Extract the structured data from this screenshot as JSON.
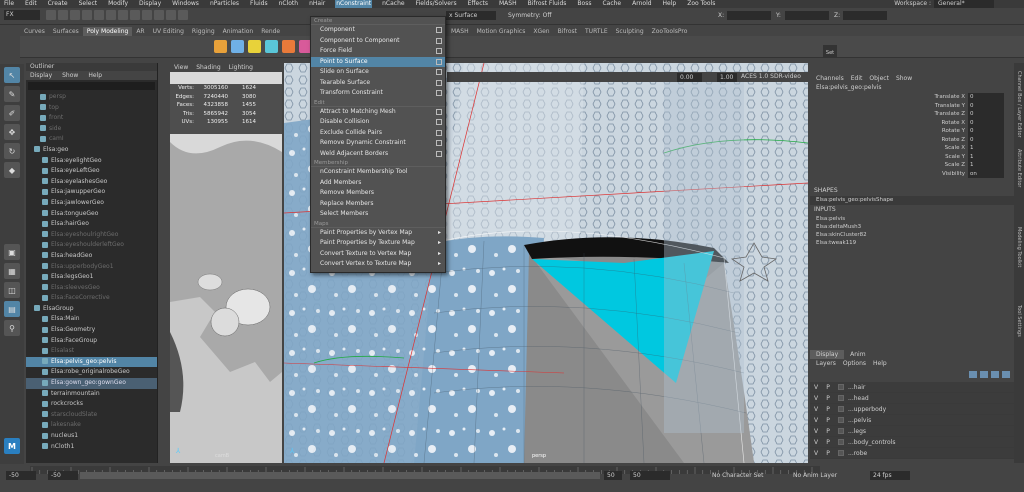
{
  "menubar": {
    "items": [
      "File",
      "Edit",
      "Create",
      "Select",
      "Modify",
      "Display",
      "Windows",
      "nParticles",
      "Fluids",
      "nCloth",
      "nHair",
      "nConstraint",
      "nCache",
      "Fields/Solvers",
      "Effects",
      "MASH",
      "Bifrost Fluids",
      "Boss",
      "Cache",
      "Arnold",
      "Help",
      "Zoo Tools"
    ],
    "active": "nConstraint",
    "workspace_label": "Workspace :",
    "workspace_value": "General*"
  },
  "statusline": {
    "mode": "FX",
    "snap_target": "x Surface",
    "symmetry": "Symmetry: Off",
    "x_label": "X:",
    "y_label": "Y:",
    "z_label": "Z:"
  },
  "shelf": {
    "tabs": [
      "Curves",
      "Surfaces",
      "Poly Modeling",
      "AR",
      "UV Editing",
      "Rigging",
      "Animation",
      "Rende"
    ],
    "active": "Poly Modeling",
    "tabs_right": [
      "MASH",
      "Motion Graphics",
      "XGen",
      "Bifrost",
      "TURTLE",
      "Sculpting",
      "ZooToolsPro"
    ],
    "set_label": "Set",
    "icon_colors": [
      "#e8a13a",
      "#6fb0e6",
      "#e8d23a",
      "#5ac6d8",
      "#e87a3a",
      "#d85a9a",
      "#7ad85a",
      "#e8a13a",
      "#6fb0e6",
      "#b07ae6",
      "#e8d23a",
      "#5ac6d8"
    ]
  },
  "outliner": {
    "title": "Outliner",
    "menu": [
      "Display",
      "Show",
      "Help"
    ],
    "items": [
      {
        "label": "persp",
        "style": "dim"
      },
      {
        "label": "top",
        "style": "dim"
      },
      {
        "label": "front",
        "style": "dim"
      },
      {
        "label": "side",
        "style": "dim"
      },
      {
        "label": "camI",
        "style": "dim"
      },
      {
        "label": "Elsa:geo",
        "style": "normal"
      },
      {
        "label": "Elsa:eyelightGeo",
        "style": "normal"
      },
      {
        "label": "Elsa:eyeLeftGeo",
        "style": "normal"
      },
      {
        "label": "Elsa:eyelashesGeo",
        "style": "normal"
      },
      {
        "label": "Elsa:jawupperGeo",
        "style": "normal"
      },
      {
        "label": "Elsa:jawlowerGeo",
        "style": "normal"
      },
      {
        "label": "Elsa:tongueGeo",
        "style": "normal"
      },
      {
        "label": "Elsa:hairGeo",
        "style": "normal"
      },
      {
        "label": "Elsa:eyeshoulrightGeo",
        "style": "dim"
      },
      {
        "label": "Elsa:eyeshoulderleftGeo",
        "style": "dim"
      },
      {
        "label": "Elsa:headGeo",
        "style": "normal"
      },
      {
        "label": "Elsa:upperbodyGeo1",
        "style": "dim"
      },
      {
        "label": "Elsa:legsGeo1",
        "style": "normal"
      },
      {
        "label": "Elsa:sleevesGeo",
        "style": "dim"
      },
      {
        "label": "Elsa:FaceCorrective",
        "style": "dim"
      },
      {
        "label": "ElsaGroup",
        "style": "normal"
      },
      {
        "label": "Elsa:Main",
        "style": "normal"
      },
      {
        "label": "Elsa:Geometry",
        "style": "normal"
      },
      {
        "label": "Elsa:FaceGroup",
        "style": "normal"
      },
      {
        "label": "Elsalast",
        "style": "dim"
      },
      {
        "label": "Elsa:pelvis_geo:pelvis",
        "style": "sel"
      },
      {
        "label": "Elsa:robe_originalrobeGeo",
        "style": "normal"
      },
      {
        "label": "Elsa:gown_geo:gownGeo",
        "style": "sel2"
      },
      {
        "label": "terrainmountain",
        "style": "normal"
      },
      {
        "label": "rockcrocks",
        "style": "normal"
      },
      {
        "label": "starscloudSlate",
        "style": "dim"
      },
      {
        "label": "lakesnake",
        "style": "dim"
      },
      {
        "label": "nucleus1",
        "style": "normal"
      },
      {
        "label": "nCloth1",
        "style": "normal"
      }
    ]
  },
  "viewport_left": {
    "menu": [
      "View",
      "Shading",
      "Lighting"
    ],
    "hud": [
      {
        "label": "Verts:",
        "v1": "3005160",
        "v2": "1624"
      },
      {
        "label": "Edges:",
        "v1": "7240440",
        "v2": "3080"
      },
      {
        "label": "Faces:",
        "v1": "4323858",
        "v2": "1455"
      },
      {
        "label": "Tris:",
        "v1": "5865942",
        "v2": "3054"
      },
      {
        "label": "UVs:",
        "v1": "130955",
        "v2": "1614"
      }
    ],
    "camera": "camB"
  },
  "viewport_right": {
    "field1": "0.00",
    "field2": "1.00",
    "colorspace": "ACES 1.0 SDR-video",
    "camera": "persp"
  },
  "dropdown": {
    "sections": [
      {
        "title": "Create",
        "items": [
          {
            "label": "Component",
            "opt": true
          },
          {
            "label": "Component to Component",
            "opt": true
          },
          {
            "label": "Force Field",
            "opt": true
          },
          {
            "label": "Point to Surface",
            "opt": true,
            "hl": true
          },
          {
            "label": "Slide on Surface",
            "opt": true
          },
          {
            "label": "Tearable Surface",
            "opt": true
          },
          {
            "label": "Transform Constraint",
            "opt": true
          }
        ]
      },
      {
        "title": "Edit",
        "items": [
          {
            "label": "Attract to Matching Mesh",
            "opt": true
          },
          {
            "label": "Disable Collision",
            "opt": true
          },
          {
            "label": "Exclude Collide Pairs",
            "opt": true
          },
          {
            "label": "Remove Dynamic Constraint",
            "opt": true
          },
          {
            "label": "Weld Adjacent Borders",
            "opt": true
          }
        ]
      },
      {
        "title": "Membership",
        "items": [
          {
            "label": "nConstraint Membership Tool",
            "opt": false
          },
          {
            "label": "Add Members",
            "opt": false
          },
          {
            "label": "Remove Members",
            "opt": false
          },
          {
            "label": "Replace Members",
            "opt": false
          },
          {
            "label": "Select Members",
            "opt": false
          }
        ]
      },
      {
        "title": "Maps",
        "items": [
          {
            "label": "Paint Properties by Vertex Map",
            "sub": true
          },
          {
            "label": "Paint Properties by Texture Map",
            "sub": true
          },
          {
            "label": "Convert Texture to Vertex Map",
            "sub": true
          },
          {
            "label": "Convert Vertex to Texture Map",
            "sub": true
          }
        ]
      }
    ]
  },
  "channelbox": {
    "menu": [
      "Channels",
      "Edit",
      "Object",
      "Show"
    ],
    "object": "Elsa:pelvis_geo:pelvis",
    "attrs": [
      {
        "name": "Translate X",
        "value": "0"
      },
      {
        "name": "Translate Y",
        "value": "0"
      },
      {
        "name": "Translate Z",
        "value": "0"
      },
      {
        "name": "Rotate X",
        "value": "0"
      },
      {
        "name": "Rotate Y",
        "value": "0"
      },
      {
        "name": "Rotate Z",
        "value": "0"
      },
      {
        "name": "Scale X",
        "value": "1"
      },
      {
        "name": "Scale Y",
        "value": "1"
      },
      {
        "name": "Scale Z",
        "value": "1"
      },
      {
        "name": "Visibility",
        "value": "on"
      }
    ],
    "shapes_label": "SHAPES",
    "shape": "Elsa:pelvis_geo:pelvisShape",
    "inputs_label": "INPUTS",
    "inputs": [
      "Elsa:pelvis",
      "Elsa:deltaMush3",
      "Elsa:skinCluster82",
      "Elsa:tweak119"
    ]
  },
  "layers": {
    "tabs": [
      "Display",
      "Anim"
    ],
    "active": "Display",
    "menu": [
      "Layers",
      "Options",
      "Help"
    ],
    "rows": [
      {
        "v": "V",
        "p": "P",
        "name": "...hair"
      },
      {
        "v": "V",
        "p": "P",
        "name": "...head"
      },
      {
        "v": "V",
        "p": "P",
        "name": "...upperbody"
      },
      {
        "v": "V",
        "p": "P",
        "name": "...pelvis"
      },
      {
        "v": "V",
        "p": "P",
        "name": "...legs"
      },
      {
        "v": "V",
        "p": "P",
        "name": "...body_controls"
      },
      {
        "v": "V",
        "p": "P",
        "name": "...robe"
      }
    ]
  },
  "sidetabs": [
    "Channel Box / Layer Editor",
    "Attribute Editor",
    "Modeling Toolkit",
    "Tool Settings"
  ],
  "timeline": {
    "start_outer": "-50",
    "start_inner": "-50",
    "end_inner": "50",
    "end_outer": "50",
    "character": "No Character Set",
    "anim_layer": "No Anim Layer",
    "fps": "24 fps"
  },
  "app_badge": "M"
}
